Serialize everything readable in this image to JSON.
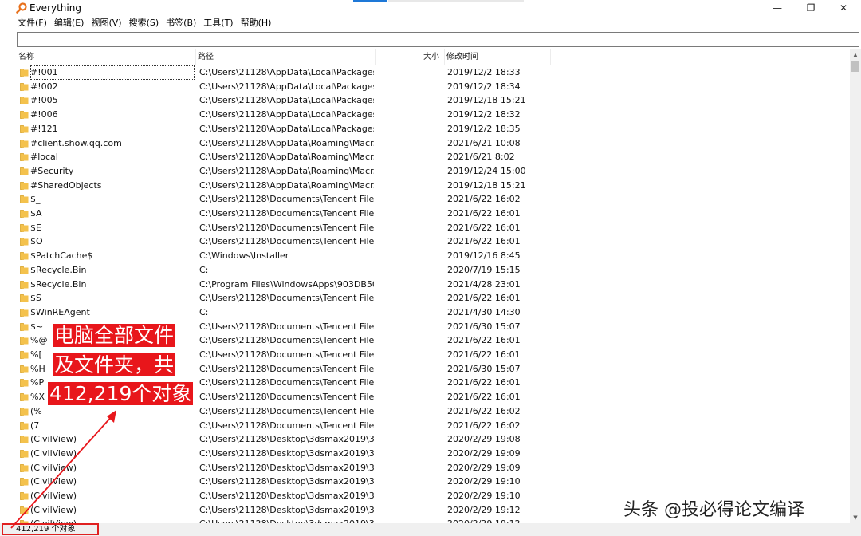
{
  "window": {
    "title": "Everything",
    "buttons": {
      "minimize": "—",
      "maximize": "❐",
      "close": "✕"
    }
  },
  "menu": [
    "文件(F)",
    "编辑(E)",
    "视图(V)",
    "搜索(S)",
    "书签(B)",
    "工具(T)",
    "帮助(H)"
  ],
  "search": {
    "value": "",
    "placeholder": ""
  },
  "columns": {
    "name": "名称",
    "path": "路径",
    "size": "大小",
    "modified": "修改时间"
  },
  "rows": [
    {
      "name": "#!001",
      "path": "C:\\Users\\21128\\AppData\\Local\\Packages...",
      "modified": "2019/12/2 18:33"
    },
    {
      "name": "#!002",
      "path": "C:\\Users\\21128\\AppData\\Local\\Packages...",
      "modified": "2019/12/2 18:34"
    },
    {
      "name": "#!005",
      "path": "C:\\Users\\21128\\AppData\\Local\\Packages...",
      "modified": "2019/12/18 15:21"
    },
    {
      "name": "#!006",
      "path": "C:\\Users\\21128\\AppData\\Local\\Packages...",
      "modified": "2019/12/2 18:32"
    },
    {
      "name": "#!121",
      "path": "C:\\Users\\21128\\AppData\\Local\\Packages...",
      "modified": "2019/12/2 18:35"
    },
    {
      "name": "#client.show.qq.com",
      "path": "C:\\Users\\21128\\AppData\\Roaming\\Macr...",
      "modified": "2021/6/21 10:08"
    },
    {
      "name": "#local",
      "path": "C:\\Users\\21128\\AppData\\Roaming\\Macr...",
      "modified": "2021/6/21 8:02"
    },
    {
      "name": "#Security",
      "path": "C:\\Users\\21128\\AppData\\Roaming\\Macr...",
      "modified": "2019/12/24 15:00"
    },
    {
      "name": "#SharedObjects",
      "path": "C:\\Users\\21128\\AppData\\Roaming\\Macr...",
      "modified": "2019/12/18 15:21"
    },
    {
      "name": "$_",
      "path": "C:\\Users\\21128\\Documents\\Tencent Files...",
      "modified": "2021/6/22 16:02"
    },
    {
      "name": "$A",
      "path": "C:\\Users\\21128\\Documents\\Tencent Files...",
      "modified": "2021/6/22 16:01"
    },
    {
      "name": "$E",
      "path": "C:\\Users\\21128\\Documents\\Tencent Files...",
      "modified": "2021/6/22 16:01"
    },
    {
      "name": "$O",
      "path": "C:\\Users\\21128\\Documents\\Tencent Files...",
      "modified": "2021/6/22 16:01"
    },
    {
      "name": "$PatchCache$",
      "path": "C:\\Windows\\Installer",
      "modified": "2019/12/16 8:45"
    },
    {
      "name": "$Recycle.Bin",
      "path": "C:",
      "modified": "2020/7/19 15:15"
    },
    {
      "name": "$Recycle.Bin",
      "path": "C:\\Program Files\\WindowsApps\\903DB50...",
      "modified": "2021/4/28 23:01"
    },
    {
      "name": "$S",
      "path": "C:\\Users\\21128\\Documents\\Tencent Files...",
      "modified": "2021/6/22 16:01"
    },
    {
      "name": "$WinREAgent",
      "path": "C:",
      "modified": "2021/4/30 14:30"
    },
    {
      "name": "$~",
      "path": "C:\\Users\\21128\\Documents\\Tencent Files...",
      "modified": "2021/6/30 15:07"
    },
    {
      "name": "%@",
      "path": "C:\\Users\\21128\\Documents\\Tencent Files...",
      "modified": "2021/6/22 16:01"
    },
    {
      "name": "%[",
      "path": "C:\\Users\\21128\\Documents\\Tencent Files...",
      "modified": "2021/6/22 16:01"
    },
    {
      "name": "%H",
      "path": "C:\\Users\\21128\\Documents\\Tencent Files...",
      "modified": "2021/6/30 15:07"
    },
    {
      "name": "%P",
      "path": "C:\\Users\\21128\\Documents\\Tencent Files...",
      "modified": "2021/6/22 16:01"
    },
    {
      "name": "%X",
      "path": "C:\\Users\\21128\\Documents\\Tencent Files...",
      "modified": "2021/6/22 16:01"
    },
    {
      "name": "(%",
      "path": "C:\\Users\\21128\\Documents\\Tencent Files...",
      "modified": "2021/6/22 16:02"
    },
    {
      "name": "(7",
      "path": "C:\\Users\\21128\\Documents\\Tencent Files...",
      "modified": "2021/6/22 16:02"
    },
    {
      "name": "(CivilView)",
      "path": "C:\\Users\\21128\\Desktop\\3dsmax2019\\3d...",
      "modified": "2020/2/29 19:08"
    },
    {
      "name": "(CivilView)",
      "path": "C:\\Users\\21128\\Desktop\\3dsmax2019\\3d...",
      "modified": "2020/2/29 19:09"
    },
    {
      "name": "(CivilView)",
      "path": "C:\\Users\\21128\\Desktop\\3dsmax2019\\3d...",
      "modified": "2020/2/29 19:09"
    },
    {
      "name": "(CivilView)",
      "path": "C:\\Users\\21128\\Desktop\\3dsmax2019\\3d...",
      "modified": "2020/2/29 19:10"
    },
    {
      "name": "(CivilView)",
      "path": "C:\\Users\\21128\\Desktop\\3dsmax2019\\3d...",
      "modified": "2020/2/29 19:10"
    },
    {
      "name": "(CivilView)",
      "path": "C:\\Users\\21128\\Desktop\\3dsmax2019\\3d...",
      "modified": "2020/2/29 19:12"
    },
    {
      "name": "(CivilView)",
      "path": "C:\\Users\\21128\\Desktop\\3dsmax2019\\3d...",
      "modified": "2020/2/29 19:12"
    }
  ],
  "status": {
    "count": "412,219 个对象"
  },
  "annotation": {
    "line1": "电脑全部文件",
    "line2": "及文件夹，共",
    "line3": "412,219个对象"
  },
  "watermark": "头条 @投必得论文编译",
  "colors": {
    "folder": "#f4c24d",
    "folder_edge": "#d9a42a",
    "annotation_red": "#e8161b",
    "accent": "#1e78d7",
    "app_icon": "#e8711c"
  }
}
